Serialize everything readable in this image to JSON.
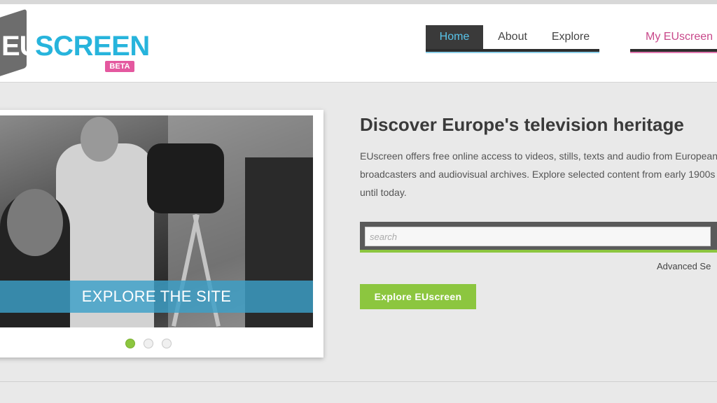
{
  "header": {
    "logo": {
      "eu": "EU",
      "screen": "SCREEN",
      "beta": "BETA"
    },
    "nav": {
      "home": "Home",
      "about": "About",
      "explore": "Explore",
      "my": "My EUscreen"
    }
  },
  "slider": {
    "banner": "EXPLORE THE SITE",
    "dots": 3,
    "active_dot": 1
  },
  "main": {
    "headline": "Discover Europe's television heritage",
    "intro": "EUscreen offers free online access to videos, stills, texts and audio from European broadcasters and audiovisual archives. Explore selected content from early 1900s until today.",
    "search": {
      "placeholder": "search",
      "value": ""
    },
    "advanced": "Advanced Se",
    "explore_button": "Explore EUscreen"
  },
  "colors": {
    "accent_blue": "#27b4dc",
    "accent_pink": "#e4589f",
    "accent_green": "#8cc63f"
  }
}
